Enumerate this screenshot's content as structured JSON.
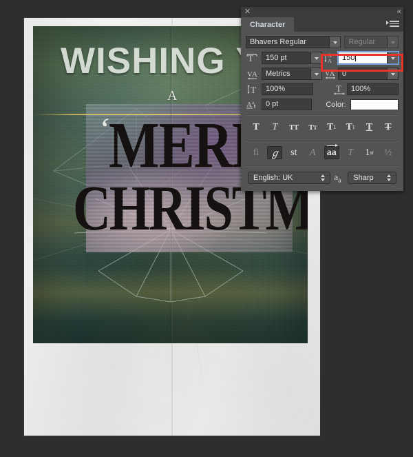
{
  "artwork": {
    "headline": "WISHING YOUR",
    "article": "A",
    "quote": "‘",
    "line1": "MERRY",
    "line2": "CHRISTMAS",
    "paper_color": "#f3f3f1",
    "ink_color": "#141110"
  },
  "panel": {
    "title": "Character",
    "close_icon": "✕",
    "collapse_icon": "«",
    "menu_icon": "panel-menu-icon",
    "font_family": {
      "value": "Bhavers Regular",
      "label": "font-family"
    },
    "font_style": {
      "value": "Regular",
      "label": "font-style",
      "disabled": true
    },
    "font_size": {
      "icon": "T̲",
      "value": "150 pt",
      "label": "font-size"
    },
    "leading": {
      "icon": "leading-icon",
      "value": "150",
      "label": "leading",
      "active": true,
      "highlighted": true
    },
    "kerning": {
      "icon": "V/A",
      "value": "Metrics",
      "label": "kerning"
    },
    "tracking": {
      "icon": "VA",
      "value": "0",
      "label": "tracking"
    },
    "vertical_scale": {
      "icon": "vertical-scale-icon",
      "value": "100%",
      "label": "vertical-scale"
    },
    "horizontal_scale": {
      "icon": "horizontal-scale-icon",
      "value": "100%",
      "label": "horizontal-scale"
    },
    "baseline_shift": {
      "icon": "baseline-shift-icon",
      "value": "0 pt",
      "label": "baseline-shift"
    },
    "color": {
      "label": "Color:",
      "value": "#ffffff"
    },
    "style_buttons": [
      {
        "name": "faux-bold",
        "glyph": "T",
        "state": "normal"
      },
      {
        "name": "faux-italic",
        "glyph": "T",
        "state": "normal"
      },
      {
        "name": "all-caps",
        "glyph": "TT",
        "state": "normal"
      },
      {
        "name": "small-caps",
        "glyph": "TT",
        "state": "normal"
      },
      {
        "name": "superscript",
        "glyph": "T",
        "state": "normal"
      },
      {
        "name": "subscript",
        "glyph": "T",
        "state": "normal"
      },
      {
        "name": "underline",
        "glyph": "T",
        "state": "normal"
      },
      {
        "name": "strikethrough",
        "glyph": "T",
        "state": "normal"
      }
    ],
    "opentype_buttons": [
      {
        "name": "standard-ligatures",
        "glyph": "fi",
        "state": "dim"
      },
      {
        "name": "contextual-alternates",
        "glyph": "℘",
        "state": "on"
      },
      {
        "name": "discretionary-ligatures",
        "glyph": "st",
        "state": "normal"
      },
      {
        "name": "swash",
        "glyph": "A",
        "state": "dim"
      },
      {
        "name": "stylistic-alternates",
        "glyph": "aa",
        "state": "on"
      },
      {
        "name": "titling-alternates",
        "glyph": "T",
        "state": "dim"
      },
      {
        "name": "ordinals",
        "glyph": "1st",
        "state": "normal"
      },
      {
        "name": "fractions",
        "glyph": "½",
        "state": "dim"
      }
    ],
    "language": {
      "value": "English: UK",
      "label": "language"
    },
    "antialias_icon": "aa",
    "antialias": {
      "value": "Sharp",
      "label": "anti-aliasing"
    }
  },
  "annotation": {
    "color": "#e8342a",
    "target": "leading-field"
  }
}
